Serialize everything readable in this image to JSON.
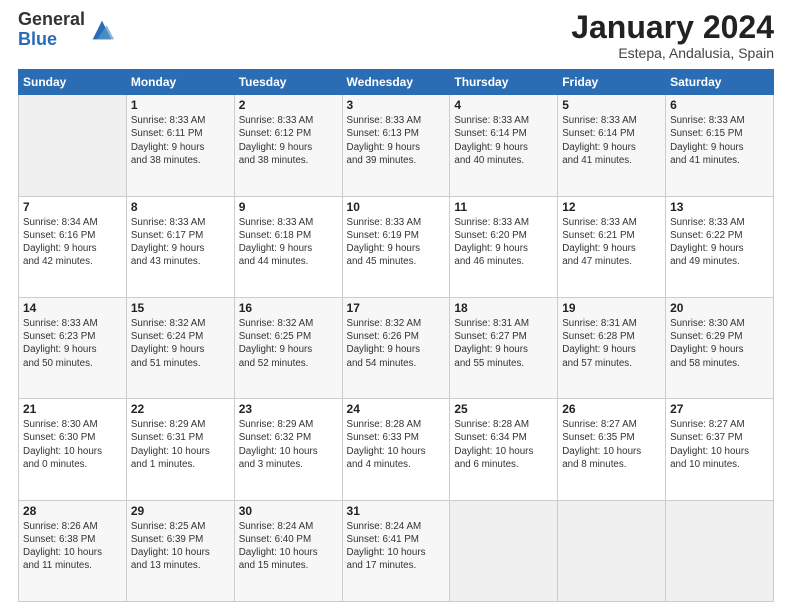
{
  "logo": {
    "general": "General",
    "blue": "Blue"
  },
  "header": {
    "title": "January 2024",
    "subtitle": "Estepa, Andalusia, Spain"
  },
  "days_of_week": [
    "Sunday",
    "Monday",
    "Tuesday",
    "Wednesday",
    "Thursday",
    "Friday",
    "Saturday"
  ],
  "weeks": [
    [
      {
        "day": "",
        "sunrise": "",
        "sunset": "",
        "daylight": ""
      },
      {
        "day": "1",
        "sunrise": "8:33 AM",
        "sunset": "6:11 PM",
        "hours": "9",
        "minutes": "38"
      },
      {
        "day": "2",
        "sunrise": "8:33 AM",
        "sunset": "6:12 PM",
        "hours": "9",
        "minutes": "38"
      },
      {
        "day": "3",
        "sunrise": "8:33 AM",
        "sunset": "6:13 PM",
        "hours": "9",
        "minutes": "39"
      },
      {
        "day": "4",
        "sunrise": "8:33 AM",
        "sunset": "6:14 PM",
        "hours": "9",
        "minutes": "40"
      },
      {
        "day": "5",
        "sunrise": "8:33 AM",
        "sunset": "6:14 PM",
        "hours": "9",
        "minutes": "41"
      },
      {
        "day": "6",
        "sunrise": "8:33 AM",
        "sunset": "6:15 PM",
        "hours": "9",
        "minutes": "41"
      }
    ],
    [
      {
        "day": "7",
        "sunrise": "8:34 AM",
        "sunset": "6:16 PM",
        "hours": "9",
        "minutes": "42"
      },
      {
        "day": "8",
        "sunrise": "8:33 AM",
        "sunset": "6:17 PM",
        "hours": "9",
        "minutes": "43"
      },
      {
        "day": "9",
        "sunrise": "8:33 AM",
        "sunset": "6:18 PM",
        "hours": "9",
        "minutes": "44"
      },
      {
        "day": "10",
        "sunrise": "8:33 AM",
        "sunset": "6:19 PM",
        "hours": "9",
        "minutes": "45"
      },
      {
        "day": "11",
        "sunrise": "8:33 AM",
        "sunset": "6:20 PM",
        "hours": "9",
        "minutes": "46"
      },
      {
        "day": "12",
        "sunrise": "8:33 AM",
        "sunset": "6:21 PM",
        "hours": "9",
        "minutes": "47"
      },
      {
        "day": "13",
        "sunrise": "8:33 AM",
        "sunset": "6:22 PM",
        "hours": "9",
        "minutes": "49"
      }
    ],
    [
      {
        "day": "14",
        "sunrise": "8:33 AM",
        "sunset": "6:23 PM",
        "hours": "9",
        "minutes": "50"
      },
      {
        "day": "15",
        "sunrise": "8:32 AM",
        "sunset": "6:24 PM",
        "hours": "9",
        "minutes": "51"
      },
      {
        "day": "16",
        "sunrise": "8:32 AM",
        "sunset": "6:25 PM",
        "hours": "9",
        "minutes": "52"
      },
      {
        "day": "17",
        "sunrise": "8:32 AM",
        "sunset": "6:26 PM",
        "hours": "9",
        "minutes": "54"
      },
      {
        "day": "18",
        "sunrise": "8:31 AM",
        "sunset": "6:27 PM",
        "hours": "9",
        "minutes": "55"
      },
      {
        "day": "19",
        "sunrise": "8:31 AM",
        "sunset": "6:28 PM",
        "hours": "9",
        "minutes": "57"
      },
      {
        "day": "20",
        "sunrise": "8:30 AM",
        "sunset": "6:29 PM",
        "hours": "9",
        "minutes": "58"
      }
    ],
    [
      {
        "day": "21",
        "sunrise": "8:30 AM",
        "sunset": "6:30 PM",
        "hours": "10",
        "minutes": "0"
      },
      {
        "day": "22",
        "sunrise": "8:29 AM",
        "sunset": "6:31 PM",
        "hours": "10",
        "minutes": "1"
      },
      {
        "day": "23",
        "sunrise": "8:29 AM",
        "sunset": "6:32 PM",
        "hours": "10",
        "minutes": "3"
      },
      {
        "day": "24",
        "sunrise": "8:28 AM",
        "sunset": "6:33 PM",
        "hours": "10",
        "minutes": "4"
      },
      {
        "day": "25",
        "sunrise": "8:28 AM",
        "sunset": "6:34 PM",
        "hours": "10",
        "minutes": "6"
      },
      {
        "day": "26",
        "sunrise": "8:27 AM",
        "sunset": "6:35 PM",
        "hours": "10",
        "minutes": "8"
      },
      {
        "day": "27",
        "sunrise": "8:27 AM",
        "sunset": "6:37 PM",
        "hours": "10",
        "minutes": "10"
      }
    ],
    [
      {
        "day": "28",
        "sunrise": "8:26 AM",
        "sunset": "6:38 PM",
        "hours": "10",
        "minutes": "11"
      },
      {
        "day": "29",
        "sunrise": "8:25 AM",
        "sunset": "6:39 PM",
        "hours": "10",
        "minutes": "13"
      },
      {
        "day": "30",
        "sunrise": "8:24 AM",
        "sunset": "6:40 PM",
        "hours": "10",
        "minutes": "15"
      },
      {
        "day": "31",
        "sunrise": "8:24 AM",
        "sunset": "6:41 PM",
        "hours": "10",
        "minutes": "17"
      },
      {
        "day": "",
        "sunrise": "",
        "sunset": "",
        "hours": "",
        "minutes": ""
      },
      {
        "day": "",
        "sunrise": "",
        "sunset": "",
        "hours": "",
        "minutes": ""
      },
      {
        "day": "",
        "sunrise": "",
        "sunset": "",
        "hours": "",
        "minutes": ""
      }
    ]
  ],
  "labels": {
    "sunrise": "Sunrise:",
    "sunset": "Sunset:",
    "daylight": "Daylight:"
  }
}
